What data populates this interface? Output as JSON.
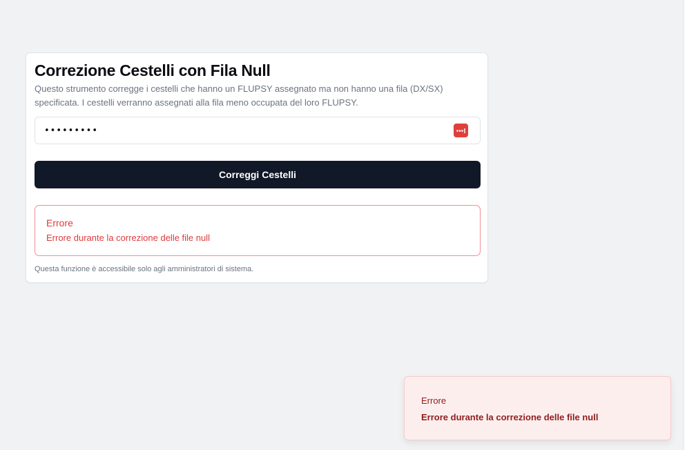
{
  "card": {
    "title": "Correzione Cestelli con Fila Null",
    "description": "Questo strumento corregge i cestelli che hanno un FLUPSY assegnato ma non hanno una fila (DX/SX) specificata. I cestelli verranno assegnati alla fila meno occupata del loro FLUPSY.",
    "password_field": {
      "value": "•••••••••",
      "icon": "password-manager-icon"
    },
    "submit_label": "Correggi Cestelli",
    "error": {
      "title": "Errore",
      "message": "Errore durante la correzione delle file null"
    },
    "footnote": "Questa funzione è accessibile solo agli amministratori di sistema."
  },
  "toast": {
    "title": "Errore",
    "message": "Errore durante la correzione delle file null"
  },
  "colors": {
    "background": "#f1f2f4",
    "primary_button": "#111827",
    "error_text": "#dc3b3b",
    "error_border": "#ef8f8f",
    "toast_background": "#fdeeee",
    "toast_text": "#8f1d1d",
    "password_icon": "#e0403a"
  }
}
